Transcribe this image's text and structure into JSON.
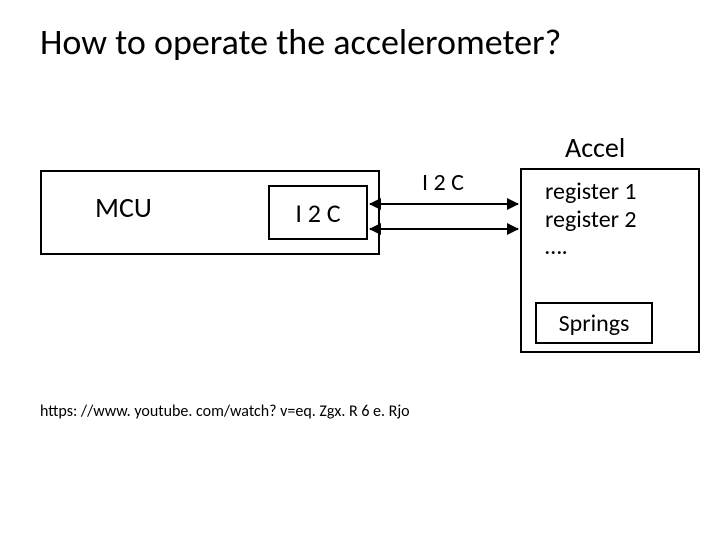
{
  "title": "How to operate the accelerometer?",
  "accel_label": "Accel",
  "mcu": {
    "label": "MCU",
    "i2c_label": "I 2 C"
  },
  "bus_label": "I 2 C",
  "accel": {
    "reg1": "register 1",
    "reg2": "register 2",
    "reg_more": "….",
    "springs": "Springs"
  },
  "link": "https: //www. youtube. com/watch? v=eq. Zgx. R 6 e. Rjo"
}
